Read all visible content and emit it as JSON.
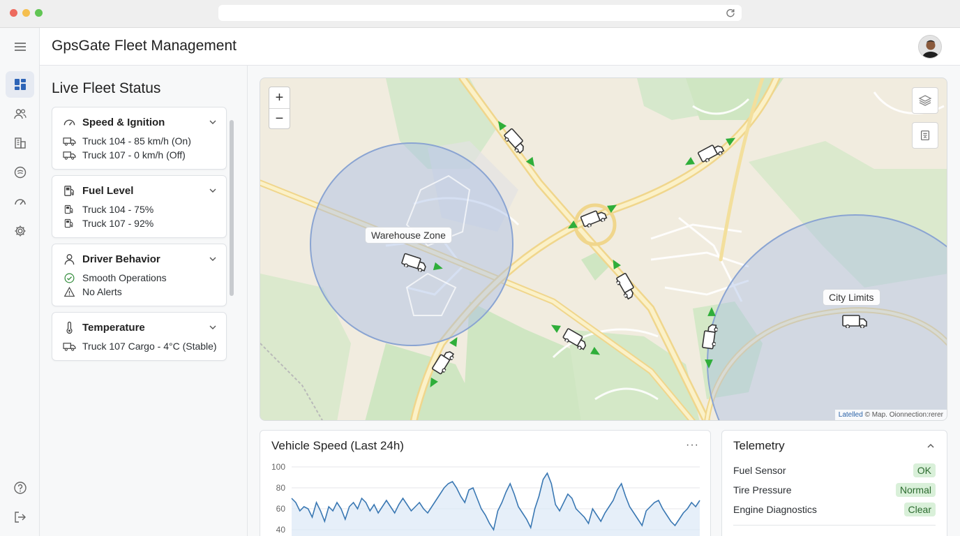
{
  "app": {
    "title": "GpsGate Fleet Management"
  },
  "rail": {
    "items": [
      "dashboard-icon",
      "users-icon",
      "buildings-icon",
      "tracking-icon",
      "speedometer-icon",
      "settings-icon"
    ],
    "bottom": [
      "help-icon",
      "logout-icon"
    ]
  },
  "panel": {
    "title": "Live Fleet Status",
    "cards": [
      {
        "title": "Speed & Ignition",
        "icon": "speedometer-icon",
        "rows": [
          {
            "icon": "truck-icon",
            "text": "Truck 104 - 85 km/h (On)"
          },
          {
            "icon": "truck-icon",
            "text": "Truck 107 - 0 km/h (Off)"
          }
        ]
      },
      {
        "title": "Fuel Level",
        "icon": "fuel-icon",
        "rows": [
          {
            "icon": "fuel-icon",
            "text": "Truck 104 - 75%"
          },
          {
            "icon": "fuel-icon",
            "text": "Truck 107 - 92%"
          }
        ]
      },
      {
        "title": "Driver Behavior",
        "icon": "person-icon",
        "rows": [
          {
            "icon": "check-circle-icon",
            "text": "Smooth Operations"
          },
          {
            "icon": "warning-icon",
            "text": "No Alerts"
          }
        ]
      },
      {
        "title": "Temperature",
        "icon": "thermometer-icon",
        "rows": [
          {
            "icon": "truck-icon",
            "text": "Truck 107 Cargo - 4°C (Stable)"
          }
        ]
      }
    ]
  },
  "map": {
    "zoom_in": "+",
    "zoom_out": "−",
    "zones": [
      "Warehouse Zone",
      "City Limits"
    ],
    "attribution_link": "Latelled",
    "attribution_text": "© Map. Oionnection:rerer",
    "colors": {
      "zone_fill": "#aabfe3",
      "zone_stroke": "#8aa4d2",
      "park": "#cfe6c2",
      "road": "#f3d98a",
      "arrow": "#2fae3a"
    }
  },
  "speed_chart": {
    "title": "Vehicle Speed (Last 24h)",
    "more": "···",
    "chart_data": {
      "type": "line",
      "title": "Vehicle Speed (Last 24h)",
      "yticks": [
        100,
        80,
        60,
        40
      ],
      "ylim": [
        30,
        100
      ],
      "grid": true,
      "series": [
        {
          "values": [
            70,
            66,
            58,
            62,
            60,
            52,
            66,
            58,
            48,
            62,
            58,
            66,
            60,
            50,
            62,
            66,
            60,
            70,
            66,
            58,
            64,
            56,
            62,
            68,
            62,
            56,
            64,
            70,
            64,
            58,
            62,
            66,
            60,
            56,
            62,
            68,
            74,
            80,
            84,
            86,
            80,
            72,
            66,
            78,
            80,
            70,
            60,
            54,
            46,
            40,
            58,
            66,
            76,
            84,
            74,
            62,
            56,
            50,
            42,
            60,
            72,
            88,
            94,
            84,
            64,
            58,
            66,
            74,
            70,
            60,
            56,
            52,
            46,
            60,
            54,
            48,
            56,
            62,
            68,
            78,
            84,
            72,
            62,
            56,
            50,
            44,
            58,
            62,
            66,
            68,
            60,
            54,
            48,
            44,
            50,
            56,
            60,
            66,
            62,
            68
          ]
        }
      ]
    }
  },
  "telemetry": {
    "title": "Telemetry",
    "rows": [
      {
        "label": "Fuel Sensor",
        "status": "OK"
      },
      {
        "label": "Tire Pressure",
        "status": "Normal"
      },
      {
        "label": "Engine Diagnostics",
        "status": "Clear"
      }
    ]
  }
}
